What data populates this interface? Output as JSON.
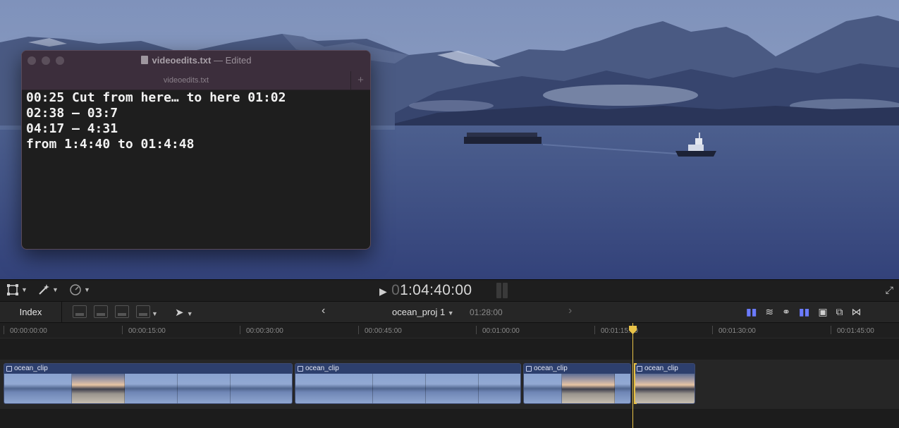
{
  "textedit": {
    "title_filename": "videoedits.txt",
    "title_sep": " — ",
    "title_status": "Edited",
    "tab_label": "videoedits.txt",
    "add_tab": "+",
    "lines": [
      "00:25 Cut from here… to here 01:02",
      "02:38 – 03:7",
      "04:17 – 4:31",
      "from 1:4:40 to 01:4:48"
    ]
  },
  "viewer": {
    "timecode_dim": "0",
    "timecode": "1:04:40:00",
    "play_icon": "play-icon"
  },
  "timeline_toolbar": {
    "index_label": "Index",
    "project_name": "ocean_proj 1",
    "project_duration": "01:28:00",
    "prev_icon": "chevron-left-icon",
    "next_icon": "chevron-right-icon"
  },
  "ruler": {
    "labels": [
      "00:00:00:00",
      "00:00:15:00",
      "00:00:30:00",
      "00:00:45:00",
      "00:01:00:00",
      "00:01:15:00",
      "00:01:30:00",
      "00:01:45:00"
    ]
  },
  "clips": [
    {
      "name": "ocean_clip"
    },
    {
      "name": "ocean_clip"
    },
    {
      "name": "ocean_clip"
    },
    {
      "name": "ocean_clip"
    }
  ],
  "colors": {
    "playhead": "#e9c348",
    "clip_header": "#2d3f6d",
    "accent_blue": "#6b7bff"
  }
}
